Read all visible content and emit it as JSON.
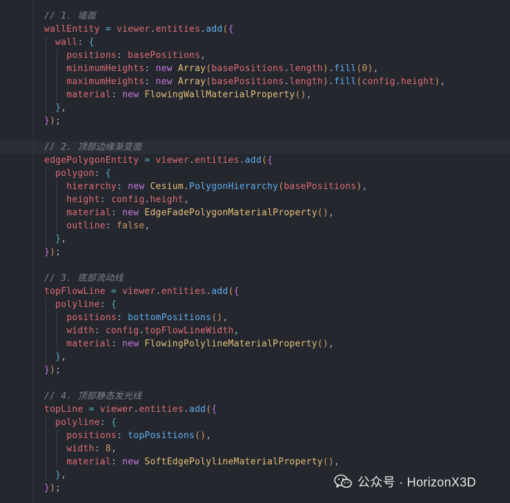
{
  "code": [
    {
      "tokens": [
        [
          "c",
          "// 1. 墙面"
        ]
      ]
    },
    {
      "tokens": [
        [
          "v",
          "wallEntity"
        ],
        [
          "o",
          " = "
        ],
        [
          "v",
          "viewer"
        ],
        [
          "p",
          "."
        ],
        [
          "v",
          "entities"
        ],
        [
          "p",
          "."
        ],
        [
          "f",
          "add"
        ],
        [
          "b1",
          "("
        ],
        [
          "b2",
          "{"
        ]
      ]
    },
    {
      "tokens": [
        [
          "p",
          "  "
        ],
        [
          "v",
          "wall"
        ],
        [
          "p",
          ": "
        ],
        [
          "b3",
          "{"
        ]
      ]
    },
    {
      "tokens": [
        [
          "p",
          "    "
        ],
        [
          "v",
          "positions"
        ],
        [
          "p",
          ": "
        ],
        [
          "v",
          "basePositions"
        ],
        [
          "p",
          ","
        ]
      ]
    },
    {
      "tokens": [
        [
          "p",
          "    "
        ],
        [
          "v",
          "minimumHeights"
        ],
        [
          "p",
          ": "
        ],
        [
          "k",
          "new "
        ],
        [
          "t",
          "Array"
        ],
        [
          "b1",
          "("
        ],
        [
          "v",
          "basePositions"
        ],
        [
          "p",
          "."
        ],
        [
          "v",
          "length"
        ],
        [
          "b1",
          ")"
        ],
        [
          "p",
          "."
        ],
        [
          "f",
          "fill"
        ],
        [
          "b1",
          "("
        ],
        [
          "n",
          "0"
        ],
        [
          "b1",
          ")"
        ],
        [
          "p",
          ","
        ]
      ]
    },
    {
      "tokens": [
        [
          "p",
          "    "
        ],
        [
          "v",
          "maximumHeights"
        ],
        [
          "p",
          ": "
        ],
        [
          "k",
          "new "
        ],
        [
          "t",
          "Array"
        ],
        [
          "b1",
          "("
        ],
        [
          "v",
          "basePositions"
        ],
        [
          "p",
          "."
        ],
        [
          "v",
          "length"
        ],
        [
          "b1",
          ")"
        ],
        [
          "p",
          "."
        ],
        [
          "f",
          "fill"
        ],
        [
          "b1",
          "("
        ],
        [
          "v",
          "config"
        ],
        [
          "p",
          "."
        ],
        [
          "v",
          "height"
        ],
        [
          "b1",
          ")"
        ],
        [
          "p",
          ","
        ]
      ]
    },
    {
      "tokens": [
        [
          "p",
          "    "
        ],
        [
          "v",
          "material"
        ],
        [
          "p",
          ": "
        ],
        [
          "k",
          "new "
        ],
        [
          "t",
          "FlowingWallMaterialProperty"
        ],
        [
          "b1",
          "()"
        ],
        [
          "p",
          ","
        ]
      ]
    },
    {
      "tokens": [
        [
          "p",
          "  "
        ],
        [
          "b3",
          "}"
        ],
        [
          "p",
          ","
        ]
      ]
    },
    {
      "tokens": [
        [
          "b2",
          "}"
        ],
        [
          "b1",
          ")"
        ],
        [
          "p",
          ";"
        ]
      ]
    },
    {
      "tokens": []
    },
    {
      "tokens": [
        [
          "c",
          "// 2. 顶部边缘渐变面"
        ]
      ]
    },
    {
      "tokens": [
        [
          "v",
          "edgePolygonEntity"
        ],
        [
          "o",
          " = "
        ],
        [
          "v",
          "viewer"
        ],
        [
          "p",
          "."
        ],
        [
          "v",
          "entities"
        ],
        [
          "p",
          "."
        ],
        [
          "f",
          "add"
        ],
        [
          "b1",
          "("
        ],
        [
          "b2",
          "{"
        ]
      ]
    },
    {
      "tokens": [
        [
          "p",
          "  "
        ],
        [
          "v",
          "polygon"
        ],
        [
          "p",
          ": "
        ],
        [
          "b3",
          "{"
        ]
      ]
    },
    {
      "tokens": [
        [
          "p",
          "    "
        ],
        [
          "v",
          "hierarchy"
        ],
        [
          "p",
          ": "
        ],
        [
          "k",
          "new "
        ],
        [
          "t",
          "Cesium"
        ],
        [
          "p",
          "."
        ],
        [
          "f",
          "PolygonHierarchy"
        ],
        [
          "b1",
          "("
        ],
        [
          "v",
          "basePositions"
        ],
        [
          "b1",
          ")"
        ],
        [
          "p",
          ","
        ]
      ]
    },
    {
      "tokens": [
        [
          "p",
          "    "
        ],
        [
          "v",
          "height"
        ],
        [
          "p",
          ": "
        ],
        [
          "v",
          "config"
        ],
        [
          "p",
          "."
        ],
        [
          "v",
          "height"
        ],
        [
          "p",
          ","
        ]
      ]
    },
    {
      "tokens": [
        [
          "p",
          "    "
        ],
        [
          "v",
          "material"
        ],
        [
          "p",
          ": "
        ],
        [
          "k",
          "new "
        ],
        [
          "t",
          "EdgeFadePolygonMaterialProperty"
        ],
        [
          "b1",
          "()"
        ],
        [
          "p",
          ","
        ]
      ]
    },
    {
      "tokens": [
        [
          "p",
          "    "
        ],
        [
          "v",
          "outline"
        ],
        [
          "p",
          ": "
        ],
        [
          "n",
          "false"
        ],
        [
          "p",
          ","
        ]
      ]
    },
    {
      "tokens": [
        [
          "p",
          "  "
        ],
        [
          "b3",
          "}"
        ],
        [
          "p",
          ","
        ]
      ]
    },
    {
      "tokens": [
        [
          "b2",
          "}"
        ],
        [
          "b1",
          ")"
        ],
        [
          "p",
          ";"
        ]
      ]
    },
    {
      "tokens": []
    },
    {
      "tokens": [
        [
          "c",
          "// 3. 底部流动线"
        ]
      ]
    },
    {
      "tokens": [
        [
          "v",
          "topFlowLine"
        ],
        [
          "o",
          " = "
        ],
        [
          "v",
          "viewer"
        ],
        [
          "p",
          "."
        ],
        [
          "v",
          "entities"
        ],
        [
          "p",
          "."
        ],
        [
          "f",
          "add"
        ],
        [
          "b1",
          "("
        ],
        [
          "b2",
          "{"
        ]
      ]
    },
    {
      "tokens": [
        [
          "p",
          "  "
        ],
        [
          "v",
          "polyline"
        ],
        [
          "p",
          ": "
        ],
        [
          "b3",
          "{"
        ]
      ]
    },
    {
      "tokens": [
        [
          "p",
          "    "
        ],
        [
          "v",
          "positions"
        ],
        [
          "p",
          ": "
        ],
        [
          "f",
          "bottomPositions"
        ],
        [
          "b1",
          "()"
        ],
        [
          "p",
          ","
        ]
      ]
    },
    {
      "tokens": [
        [
          "p",
          "    "
        ],
        [
          "v",
          "width"
        ],
        [
          "p",
          ": "
        ],
        [
          "v",
          "config"
        ],
        [
          "p",
          "."
        ],
        [
          "v",
          "topFlowLineWidth"
        ],
        [
          "p",
          ","
        ]
      ]
    },
    {
      "tokens": [
        [
          "p",
          "    "
        ],
        [
          "v",
          "material"
        ],
        [
          "p",
          ": "
        ],
        [
          "k",
          "new "
        ],
        [
          "t",
          "FlowingPolylineMaterialProperty"
        ],
        [
          "b1",
          "()"
        ],
        [
          "p",
          ","
        ]
      ]
    },
    {
      "tokens": [
        [
          "p",
          "  "
        ],
        [
          "b3",
          "}"
        ],
        [
          "p",
          ","
        ]
      ]
    },
    {
      "tokens": [
        [
          "b2",
          "}"
        ],
        [
          "b1",
          ")"
        ],
        [
          "p",
          ";"
        ]
      ]
    },
    {
      "tokens": []
    },
    {
      "tokens": [
        [
          "c",
          "// 4. 顶部静态发光线"
        ]
      ]
    },
    {
      "tokens": [
        [
          "v",
          "topLine"
        ],
        [
          "o",
          " = "
        ],
        [
          "v",
          "viewer"
        ],
        [
          "p",
          "."
        ],
        [
          "v",
          "entities"
        ],
        [
          "p",
          "."
        ],
        [
          "f",
          "add"
        ],
        [
          "b1",
          "("
        ],
        [
          "b2",
          "{"
        ]
      ]
    },
    {
      "tokens": [
        [
          "p",
          "  "
        ],
        [
          "v",
          "polyline"
        ],
        [
          "p",
          ": "
        ],
        [
          "b3",
          "{"
        ]
      ]
    },
    {
      "tokens": [
        [
          "p",
          "    "
        ],
        [
          "v",
          "positions"
        ],
        [
          "p",
          ": "
        ],
        [
          "f",
          "topPositions"
        ],
        [
          "b1",
          "()"
        ],
        [
          "p",
          ","
        ]
      ]
    },
    {
      "tokens": [
        [
          "p",
          "    "
        ],
        [
          "v",
          "width"
        ],
        [
          "p",
          ": "
        ],
        [
          "n",
          "8"
        ],
        [
          "p",
          ","
        ]
      ]
    },
    {
      "tokens": [
        [
          "p",
          "    "
        ],
        [
          "v",
          "material"
        ],
        [
          "p",
          ": "
        ],
        [
          "k",
          "new "
        ],
        [
          "t",
          "SoftEdgePolylineMaterialProperty"
        ],
        [
          "b1",
          "()"
        ],
        [
          "p",
          ","
        ]
      ]
    },
    {
      "tokens": [
        [
          "p",
          "  "
        ],
        [
          "b3",
          "}"
        ],
        [
          "p",
          ","
        ]
      ]
    },
    {
      "tokens": [
        [
          "b2",
          "}"
        ],
        [
          "b1",
          ")"
        ],
        [
          "p",
          ";"
        ]
      ]
    }
  ],
  "watermark": {
    "icon": "wechat-icon",
    "text": "公众号 · HorizonX3D"
  },
  "colors": {
    "background": "#24272e",
    "comment": "#7f848e",
    "variable": "#e06c75",
    "function": "#61afef",
    "keyword": "#c678dd",
    "type": "#e5c07b",
    "number": "#d19a66",
    "operator": "#56b6c2"
  }
}
